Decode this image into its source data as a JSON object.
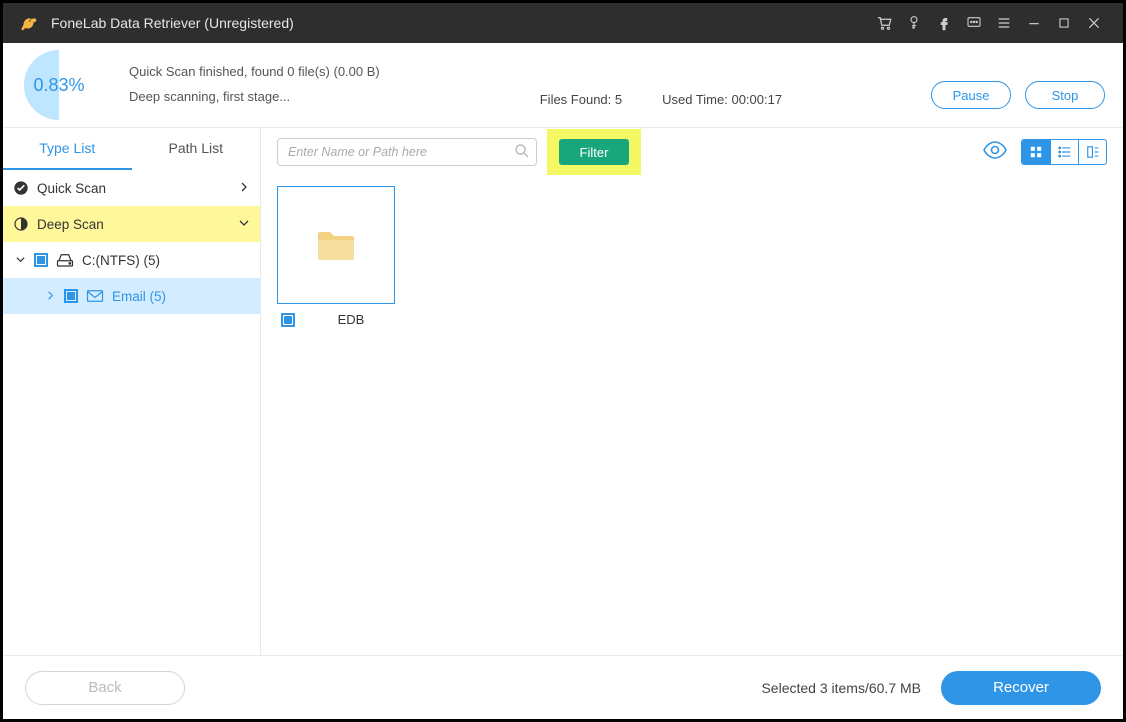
{
  "titlebar": {
    "title": "FoneLab Data Retriever (Unregistered)"
  },
  "status": {
    "percent": "0.83%",
    "line1": "Quick Scan finished, found 0 file(s) (0.00  B)",
    "line2": "Deep scanning, first stage...",
    "files_found_label": "Files Found: 5",
    "used_time_label": "Used Time: 00:00:17",
    "pause": "Pause",
    "stop": "Stop"
  },
  "sidebar": {
    "tab_type": "Type List",
    "tab_path": "Path List",
    "quick_scan": "Quick Scan",
    "deep_scan": "Deep Scan",
    "drive": "C:(NTFS) (5)",
    "email": "Email (5)"
  },
  "toolbar": {
    "search_placeholder": "Enter Name or Path here",
    "filter": "Filter"
  },
  "grid": {
    "item1": "EDB"
  },
  "footer": {
    "back": "Back",
    "selection": "Selected 3 items/60.7 MB",
    "recover": "Recover"
  }
}
